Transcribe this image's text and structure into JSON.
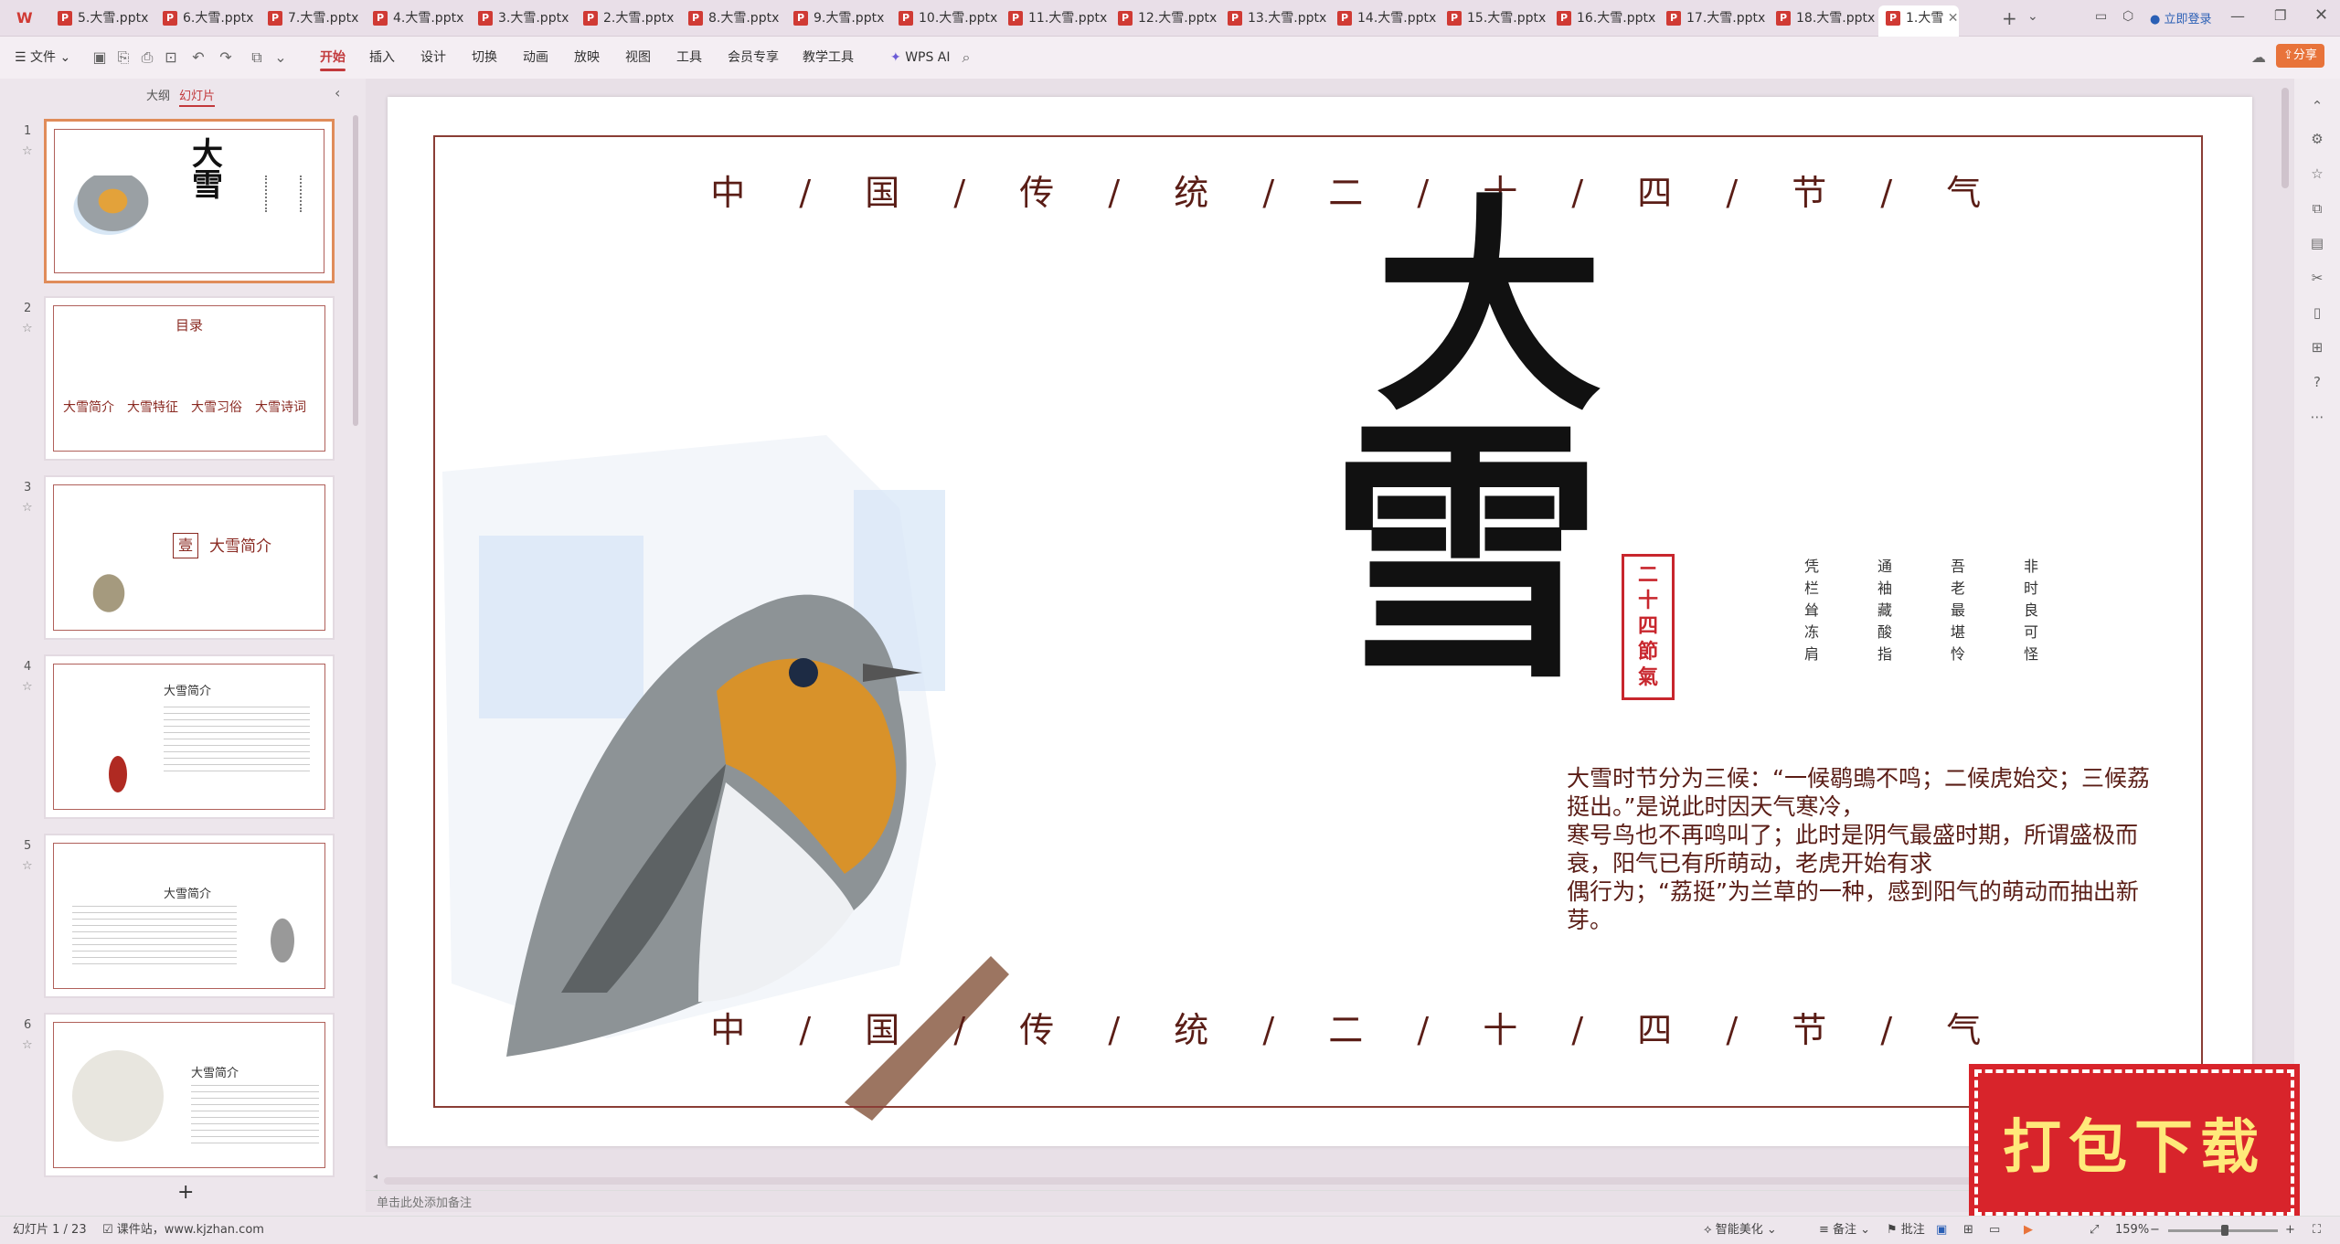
{
  "tabs": [
    {
      "label": "5.大雪.pptx"
    },
    {
      "label": "6.大雪.pptx"
    },
    {
      "label": "7.大雪.pptx"
    },
    {
      "label": "4.大雪.pptx"
    },
    {
      "label": "3.大雪.pptx"
    },
    {
      "label": "2.大雪.pptx"
    },
    {
      "label": "8.大雪.pptx"
    },
    {
      "label": "9.大雪.pptx"
    },
    {
      "label": "10.大雪.pptx"
    },
    {
      "label": "11.大雪.pptx"
    },
    {
      "label": "12.大雪.pptx"
    },
    {
      "label": "13.大雪.pptx"
    },
    {
      "label": "14.大雪.pptx"
    },
    {
      "label": "15.大雪.pptx"
    },
    {
      "label": "16.大雪.pptx"
    },
    {
      "label": "17.大雪.pptx"
    },
    {
      "label": "18.大雪.pptx"
    },
    {
      "label": "1.大雪"
    }
  ],
  "titlebar": {
    "login": "立即登录",
    "share": "分享"
  },
  "menus": {
    "file": "文件",
    "home": "开始",
    "insert": "插入",
    "design": "设计",
    "transition": "切换",
    "animation": "动画",
    "slideshow": "放映",
    "view": "视图",
    "tools": "工具",
    "member": "会员专享",
    "teaching": "教学工具",
    "ai": "WPS AI"
  },
  "sidepanel": {
    "tab_outline": "大纲",
    "tab_slides": "幻灯片",
    "add": "+"
  },
  "thumbs": [
    {
      "num": "1",
      "title": "大雪"
    },
    {
      "num": "2",
      "title": "目录",
      "items": [
        "大雪简介",
        "大雪特征",
        "大雪习俗",
        "大雪诗词"
      ]
    },
    {
      "num": "3",
      "title": "大雪简介",
      "badge": "壹"
    },
    {
      "num": "4",
      "title": "大雪简介"
    },
    {
      "num": "5",
      "title": "大雪简介"
    },
    {
      "num": "6",
      "title": "大雪简介"
    }
  ],
  "slide": {
    "top_title": [
      "中",
      "/",
      "国",
      "/",
      "传",
      "/",
      "统",
      "/",
      "二",
      "/",
      "十",
      "/",
      "四",
      "/",
      "节",
      "/",
      "气"
    ],
    "big_char_1": "大",
    "big_char_2": "雪",
    "seal": [
      "二",
      "十",
      "四",
      "節",
      "氣"
    ],
    "poem_cols": [
      [
        "非",
        "时",
        "良",
        "可",
        "怪"
      ],
      [
        "吾",
        "老",
        "最",
        "堪",
        "怜"
      ],
      [
        "通",
        "袖",
        "藏",
        "酸",
        "指"
      ],
      [
        "凭",
        "栏",
        "耸",
        "冻",
        "肩"
      ]
    ],
    "desc": [
      "大雪时节分为三候：“一候鹖鴠不鸣；二候虎始交；三候荔挺出。”是说此时因天气寒冷，",
      "寒号鸟也不再鸣叫了；此时是阴气最盛时期，所谓盛极而衰，阳气已有所萌动，老虎开始有求",
      "偶行为；“荔挺”为兰草的一种，感到阳气的萌动而抽出新芽。"
    ]
  },
  "notes_placeholder": "单击此处添加备注",
  "status": {
    "slide_info": "幻灯片 1 / 23",
    "source": "课件站，www.kjzhan.com",
    "beautify": "智能美化",
    "notes": "备注",
    "comment": "批注",
    "zoom": "159%"
  },
  "download": {
    "label": "打包下载"
  },
  "colors": {
    "accent": "#c2393c",
    "frame": "#8a3d35",
    "text": "#5a1d16"
  }
}
